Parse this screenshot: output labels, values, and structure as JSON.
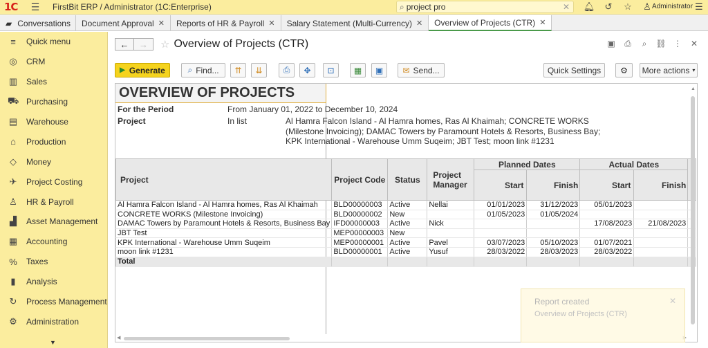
{
  "app": {
    "logo_text": "1C",
    "title": "FirstBit ERP / Administrator  (1C:Enterprise)",
    "search_value": "project pro",
    "user": "Administrator"
  },
  "tabs": [
    {
      "label": "Conversations"
    },
    {
      "label": "Document Approval"
    },
    {
      "label": "Reports of HR & Payroll"
    },
    {
      "label": "Salary Statement (Multi-Currency)"
    },
    {
      "label": "Overview of Projects (CTR)"
    }
  ],
  "sidebar": {
    "items": [
      {
        "label": "Quick menu",
        "icon": "≡"
      },
      {
        "label": "CRM",
        "icon": "◎"
      },
      {
        "label": "Sales",
        "icon": "▥"
      },
      {
        "label": "Purchasing",
        "icon": "⛟"
      },
      {
        "label": "Warehouse",
        "icon": "▤"
      },
      {
        "label": "Production",
        "icon": "⌂"
      },
      {
        "label": "Money",
        "icon": "◇"
      },
      {
        "label": "Project Costing",
        "icon": "✈"
      },
      {
        "label": "HR & Payroll",
        "icon": "♙"
      },
      {
        "label": "Asset Management",
        "icon": "▟"
      },
      {
        "label": "Accounting",
        "icon": "▦"
      },
      {
        "label": "Taxes",
        "icon": "%"
      },
      {
        "label": "Analysis",
        "icon": "▮"
      },
      {
        "label": "Process Management",
        "icon": "↻"
      },
      {
        "label": "Administration",
        "icon": "⚙"
      }
    ]
  },
  "page": {
    "title": "Overview of Projects (CTR)"
  },
  "toolbar": {
    "generate": "Generate",
    "find": "Find...",
    "send": "Send...",
    "quick_settings": "Quick Settings",
    "more_actions": "More actions"
  },
  "report": {
    "title": "OVERVIEW OF PROJECTS",
    "period_label": "For the Period",
    "period_value": "From January 01, 2022 to December 10, 2024",
    "project_label": "Project",
    "project_cond": "In list",
    "project_list_lines": [
      "Al Hamra Falcon Island - Al Hamra homes, Ras Al Khaimah; CONCRETE WORKS",
      "(Milestone Invoicing); DAMAC Towers by Paramount Hotels & Resorts, Business Bay;",
      "KPK International - Warehouse Umm Suqeim; JBT Test; moon link #1231"
    ],
    "columns": {
      "project": "Project",
      "code": "Project Code",
      "status": "Status",
      "manager": "Project Manager",
      "planned": "Planned Dates",
      "actual": "Actual Dates",
      "start": "Start",
      "finish": "Finish"
    },
    "rows": [
      {
        "project": "Al Hamra Falcon Island - Al Hamra homes, Ras Al Khaimah",
        "code": "BLD00000003",
        "status": "Active",
        "manager": "Nellai",
        "p_start": "01/01/2023",
        "p_finish": "31/12/2023",
        "a_start": "05/01/2023",
        "a_finish": ""
      },
      {
        "project": "CONCRETE WORKS (Milestone Invoicing)",
        "code": "BLD00000002",
        "status": "New",
        "manager": "",
        "p_start": "01/05/2023",
        "p_finish": "01/05/2024",
        "a_start": "",
        "a_finish": ""
      },
      {
        "project": "DAMAC Towers by Paramount Hotels & Resorts, Business Bay",
        "code": "IFD00000003",
        "status": "Active",
        "manager": "Nick",
        "p_start": "",
        "p_finish": "",
        "a_start": "17/08/2023",
        "a_finish": "21/08/2023"
      },
      {
        "project": "JBT Test",
        "code": "MEP00000003",
        "status": "New",
        "manager": "",
        "p_start": "",
        "p_finish": "",
        "a_start": "",
        "a_finish": ""
      },
      {
        "project": "KPK International - Warehouse Umm Suqeim",
        "code": "MEP00000001",
        "status": "Active",
        "manager": "Pavel",
        "p_start": "03/07/2023",
        "p_finish": "05/10/2023",
        "a_start": "01/07/2021",
        "a_finish": ""
      },
      {
        "project": "moon link #1231",
        "code": "BLD00000001",
        "status": "Active",
        "manager": "Yusuf",
        "p_start": "28/03/2022",
        "p_finish": "28/03/2023",
        "a_start": "28/03/2022",
        "a_finish": ""
      }
    ],
    "total_label": "Total"
  },
  "toast": {
    "title": "Report created",
    "message": "Overview of Projects (CTR)"
  }
}
